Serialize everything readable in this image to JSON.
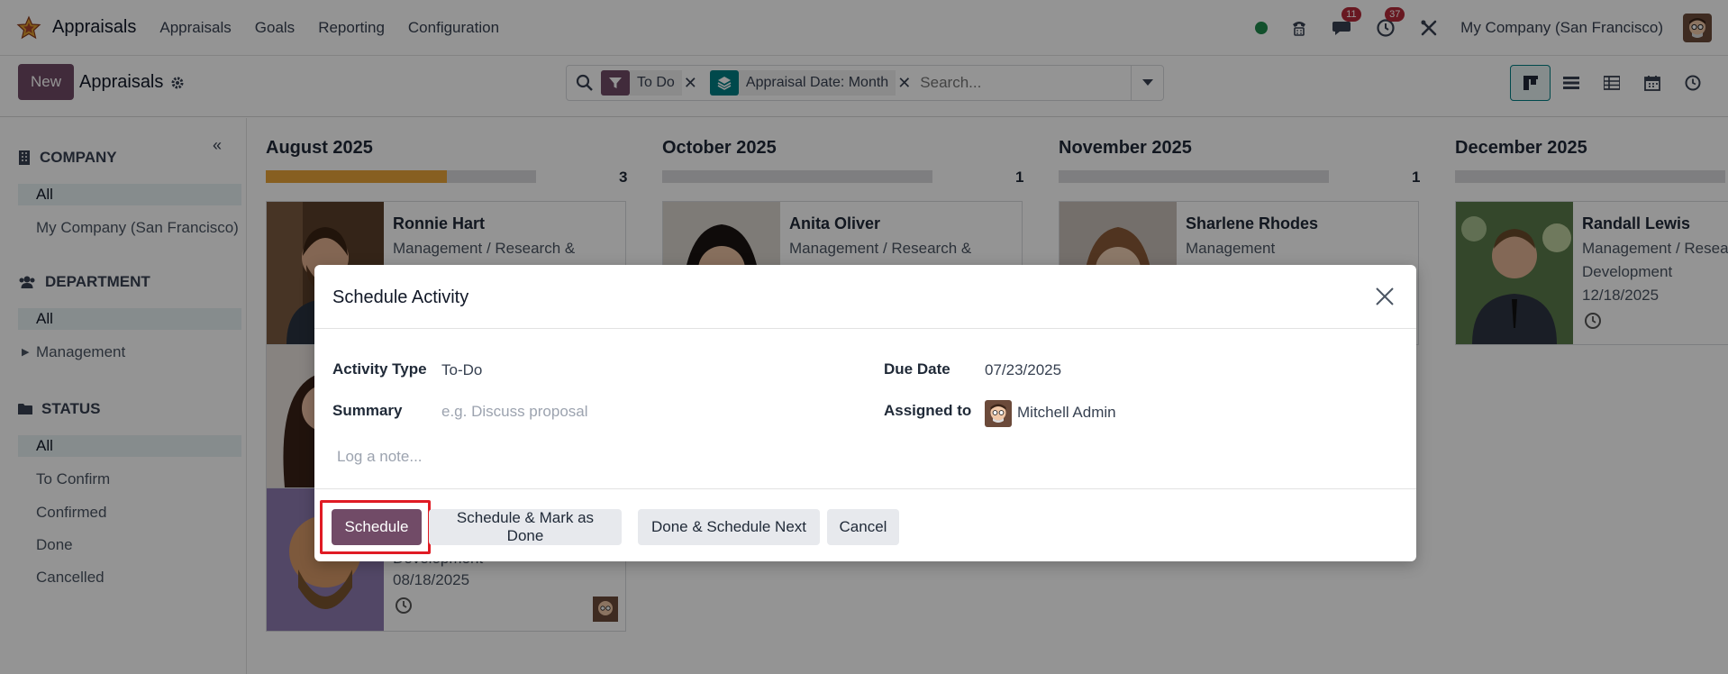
{
  "navbar": {
    "app_name": "Appraisals",
    "menus": [
      "Appraisals",
      "Goals",
      "Reporting",
      "Configuration"
    ],
    "messages_badge": "11",
    "activities_badge": "37",
    "company": "My Company (San Francisco)"
  },
  "control": {
    "new_label": "New",
    "breadcrumb": "Appraisals",
    "facets": [
      {
        "label": "To Do",
        "color": "#714b67"
      },
      {
        "label": "Appraisal Date: Month",
        "color": "#017e84"
      }
    ],
    "search_placeholder": "Search..."
  },
  "sidebar": {
    "sections": [
      {
        "title": "COMPANY",
        "icon": "building-icon",
        "items": [
          {
            "label": "All",
            "active": true
          },
          {
            "label": "My Company (San Francisco)"
          }
        ]
      },
      {
        "title": "DEPARTMENT",
        "icon": "users-icon",
        "items": [
          {
            "label": "All",
            "active": true
          },
          {
            "label": "Management"
          }
        ]
      },
      {
        "title": "STATUS",
        "icon": "folder-icon",
        "items": [
          {
            "label": "All",
            "active": true
          },
          {
            "label": "To Confirm"
          },
          {
            "label": "Confirmed"
          },
          {
            "label": "Done"
          },
          {
            "label": "Cancelled"
          }
        ]
      }
    ]
  },
  "kanban": {
    "columns": [
      {
        "title": "August 2025",
        "count": "3",
        "progress": 0.67,
        "cards": [
          {
            "name": "Ronnie Hart",
            "line1": "Management / Research &",
            "line2": "",
            "date": ""
          },
          {
            "name": "",
            "line1": "",
            "line2": "",
            "date": ""
          },
          {
            "name": "",
            "line1": "",
            "line2": "Development",
            "date": "08/18/2025"
          }
        ]
      },
      {
        "title": "October 2025",
        "count": "1",
        "progress": 0,
        "cards": [
          {
            "name": "Anita Oliver",
            "line1": "Management / Research &",
            "line2": "",
            "date": ""
          }
        ]
      },
      {
        "title": "November 2025",
        "count": "1",
        "progress": 0,
        "cards": [
          {
            "name": "Sharlene Rhodes",
            "line1": "Management",
            "line2": "",
            "date": ""
          }
        ]
      },
      {
        "title": "December 2025",
        "count": "",
        "progress": 0,
        "cards": [
          {
            "name": "Randall Lewis",
            "line1": "Management / Resea",
            "line2": "Development",
            "date": "12/18/2025"
          }
        ]
      }
    ]
  },
  "dialog": {
    "title": "Schedule Activity",
    "activity_type_label": "Activity Type",
    "activity_type_value": "To-Do",
    "summary_label": "Summary",
    "summary_placeholder": "e.g. Discuss proposal",
    "due_date_label": "Due Date",
    "due_date_value": "07/23/2025",
    "assigned_label": "Assigned to",
    "assigned_value": "Mitchell Admin",
    "note_placeholder": "Log a note...",
    "buttons": {
      "schedule": "Schedule",
      "schedule_done": "Schedule & Mark as Done",
      "done_next": "Done & Schedule Next",
      "cancel": "Cancel"
    }
  }
}
